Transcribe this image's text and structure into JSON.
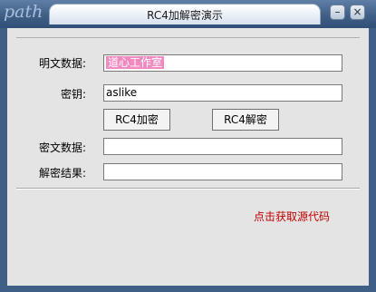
{
  "window": {
    "title": "RC4加解密演示",
    "logo_text": "path",
    "min_glyph": "–",
    "close_glyph": "×"
  },
  "form": {
    "plaintext_label": "明文数据:",
    "plaintext_value": "道心工作室",
    "key_label": "密钥:",
    "key_value": "aslike",
    "ciphertext_label": "密文数据:",
    "ciphertext_value": "",
    "result_label": "解密结果:",
    "result_value": ""
  },
  "buttons": {
    "encrypt": "RC4加密",
    "decrypt": "RC4解密"
  },
  "link": {
    "text": "点击获取源代码"
  },
  "colors": {
    "title_bar": "#3f5f87",
    "link": "#c00000",
    "selection": "#f08ac0"
  },
  "icons": [
    "minimize-icon",
    "close-icon"
  ]
}
